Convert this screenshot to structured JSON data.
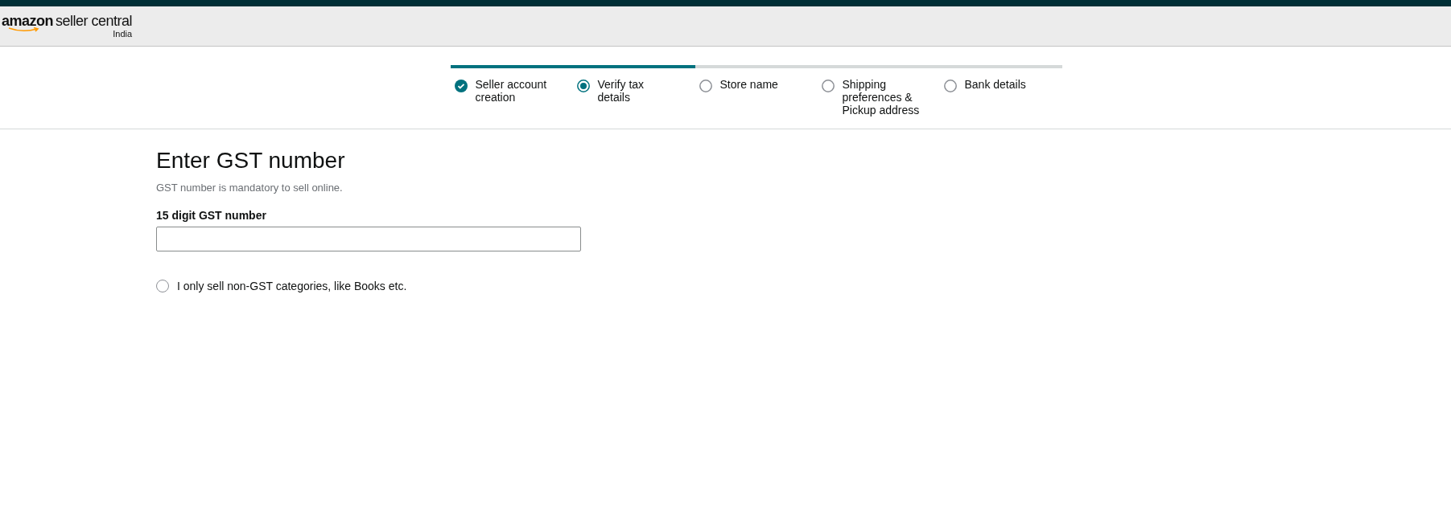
{
  "header": {
    "logo": {
      "brand": "amazon",
      "product": "seller central",
      "region": "India"
    }
  },
  "stepper": {
    "level": 0.4,
    "steps": [
      {
        "label": "Seller account creation",
        "kind": "done"
      },
      {
        "label": "Verify tax details",
        "kind": "current"
      },
      {
        "label": "Store name",
        "kind": "pending"
      },
      {
        "label": "Shipping preferences & Pickup address",
        "kind": "pending"
      },
      {
        "label": "Bank details",
        "kind": "pending"
      }
    ]
  },
  "form": {
    "title": "Enter GST number",
    "subtitle": "GST number is mandatory to sell online.",
    "field_label": "15 digit GST number",
    "option": {
      "label": "I only sell non-GST categories, like Books etc.",
      "selected": false
    }
  }
}
